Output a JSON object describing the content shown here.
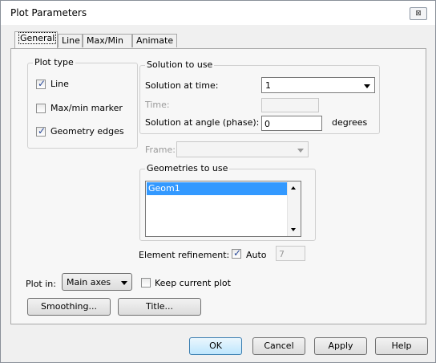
{
  "window": {
    "title": "Plot Parameters",
    "close_label": "⊠"
  },
  "tabs": [
    {
      "label": "General"
    },
    {
      "label": "Line"
    },
    {
      "label": "Max/Min"
    },
    {
      "label": "Animate"
    }
  ],
  "plot_type": {
    "title": "Plot type",
    "items": [
      {
        "label": "Line",
        "checked": true
      },
      {
        "label": "Max/min marker",
        "checked": false
      },
      {
        "label": "Geometry edges",
        "checked": true
      }
    ]
  },
  "solution": {
    "title": "Solution to use",
    "time_label": "Solution at time:",
    "time_value": "1",
    "time_field_label": "Time:",
    "time_field_value": "",
    "angle_label": "Solution at angle (phase):",
    "angle_value": "0",
    "angle_unit": "degrees"
  },
  "frame": {
    "label": "Frame:",
    "value": ""
  },
  "geometries": {
    "title": "Geometries to use",
    "items": [
      "Geom1"
    ]
  },
  "refinement": {
    "label": "Element refinement:",
    "auto_label": "Auto",
    "auto_checked": true,
    "value": "7"
  },
  "plot_in": {
    "label": "Plot in:",
    "value": "Main axes",
    "keep_label": "Keep current plot",
    "keep_checked": false
  },
  "buttons": {
    "smoothing": "Smoothing...",
    "title": "Title...",
    "ok": "OK",
    "cancel": "Cancel",
    "apply": "Apply",
    "help": "Help"
  },
  "colors": {
    "selection": "#3399ff",
    "check": "#2a4a9a"
  }
}
